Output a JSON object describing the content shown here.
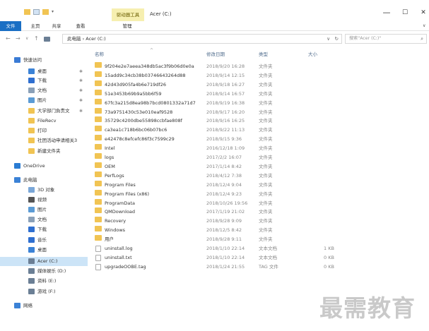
{
  "titlebar": {
    "context_tab": "驱动器工具",
    "title": "Acer (C:)",
    "minimize": "—",
    "maximize": "☐",
    "close": "✕"
  },
  "ribbon": {
    "tabs": [
      "文件",
      "主页",
      "共享",
      "查看",
      "管理"
    ]
  },
  "address": {
    "path": "此电脑 › Acer (C:)",
    "search_placeholder": "搜索\"Acer (C:)\""
  },
  "sidebar": {
    "items": [
      {
        "label": "快速访问",
        "icon": "star-icon",
        "color": "#3a7bd5"
      },
      {
        "label": "桌面",
        "icon": "desktop-icon",
        "color": "#3b82d6",
        "pinned": true
      },
      {
        "label": "下载",
        "icon": "download-icon",
        "color": "#2f6fd0",
        "pinned": true
      },
      {
        "label": "文档",
        "icon": "document-icon",
        "color": "#8aa0b8",
        "pinned": true
      },
      {
        "label": "图片",
        "icon": "picture-icon",
        "color": "#5b9bd5",
        "pinned": true
      },
      {
        "label": "大学部门負责文",
        "icon": "folder-icon",
        "color": "#f1c453",
        "pinned": true
      },
      {
        "label": "FileRecv",
        "icon": "folder-icon",
        "color": "#f1c453"
      },
      {
        "label": "打印",
        "icon": "folder-icon",
        "color": "#f1c453"
      },
      {
        "label": "社团活动申请相关3",
        "icon": "folder-icon",
        "color": "#f1c453"
      },
      {
        "label": "新建文件夹",
        "icon": "folder-icon",
        "color": "#f1c453"
      },
      {
        "label": "OneDrive",
        "icon": "cloud-icon",
        "color": "#2b7cd3"
      },
      {
        "label": "此电脑",
        "icon": "computer-icon",
        "color": "#3b82d6"
      },
      {
        "label": "3D 对象",
        "icon": "cube-icon",
        "color": "#7aa7d8"
      },
      {
        "label": "视频",
        "icon": "video-icon",
        "color": "#555555"
      },
      {
        "label": "图片",
        "icon": "picture-icon",
        "color": "#5b9bd5"
      },
      {
        "label": "文档",
        "icon": "document-icon",
        "color": "#8aa0b8"
      },
      {
        "label": "下载",
        "icon": "download-icon",
        "color": "#2f6fd0"
      },
      {
        "label": "音乐",
        "icon": "music-icon",
        "color": "#2f6fd0"
      },
      {
        "label": "桌面",
        "icon": "desktop-icon",
        "color": "#3b82d6"
      },
      {
        "label": "Acer (C:)",
        "icon": "drive-icon",
        "color": "#6b7f95",
        "selected": true
      },
      {
        "label": "媒体娱乐 (D:)",
        "icon": "drive-icon",
        "color": "#6b7f95"
      },
      {
        "label": "资料 (E:)",
        "icon": "drive-icon",
        "color": "#6b7f95"
      },
      {
        "label": "游戏 (F:)",
        "icon": "drive-icon",
        "color": "#6b7f95"
      },
      {
        "label": "网络",
        "icon": "network-icon",
        "color": "#3b82d6"
      }
    ]
  },
  "columns": {
    "name": "名称",
    "date": "修改日期",
    "type": "类型",
    "size": "大小"
  },
  "files": [
    {
      "name": "9f204e2e7aeea348db5ac3f9b06d0e0a",
      "date": "2018/9/20 16:28",
      "type": "文件夹",
      "size": "",
      "kind": "folder"
    },
    {
      "name": "15add9c34cb38b03746643264d88",
      "date": "2018/9/14 12:15",
      "type": "文件夹",
      "size": "",
      "kind": "folder"
    },
    {
      "name": "42d43d905fa4b6e719df26",
      "date": "2018/9/18 16:27",
      "type": "文件夹",
      "size": "",
      "kind": "folder"
    },
    {
      "name": "51e3453b69b9a5bb6f59",
      "date": "2018/9/14 16:57",
      "type": "文件夹",
      "size": "",
      "kind": "folder"
    },
    {
      "name": "67fc3a215d8ea98b7bcd0801332a71d7",
      "date": "2018/9/19 16:38",
      "type": "文件夹",
      "size": "",
      "kind": "folder"
    },
    {
      "name": "73a9751430c53e010eaf9528",
      "date": "2018/9/17 16:20",
      "type": "文件夹",
      "size": "",
      "kind": "folder"
    },
    {
      "name": "35729c4200dbe55898ccbfae808f",
      "date": "2018/9/16 16:25",
      "type": "文件夹",
      "size": "",
      "kind": "folder"
    },
    {
      "name": "ca3ea1c718b6bc06b07bc6",
      "date": "2018/9/22 11:13",
      "type": "文件夹",
      "size": "",
      "kind": "folder"
    },
    {
      "name": "e42478c8efcefc86f3c7599c29",
      "date": "2018/9/15 9:36",
      "type": "文件夹",
      "size": "",
      "kind": "folder"
    },
    {
      "name": "Intel",
      "date": "2016/12/18 1:09",
      "type": "文件夹",
      "size": "",
      "kind": "folder"
    },
    {
      "name": "logs",
      "date": "2017/2/2 16:07",
      "type": "文件夹",
      "size": "",
      "kind": "folder"
    },
    {
      "name": "OEM",
      "date": "2017/1/14 8:42",
      "type": "文件夹",
      "size": "",
      "kind": "folder"
    },
    {
      "name": "PerfLogs",
      "date": "2018/4/12 7:38",
      "type": "文件夹",
      "size": "",
      "kind": "folder"
    },
    {
      "name": "Program Files",
      "date": "2018/12/4 9:04",
      "type": "文件夹",
      "size": "",
      "kind": "folder"
    },
    {
      "name": "Program Files (x86)",
      "date": "2018/12/4 9:23",
      "type": "文件夹",
      "size": "",
      "kind": "folder"
    },
    {
      "name": "ProgramData",
      "date": "2018/10/26 19:56",
      "type": "文件夹",
      "size": "",
      "kind": "folder"
    },
    {
      "name": "QMDownload",
      "date": "2017/1/19 21:02",
      "type": "文件夹",
      "size": "",
      "kind": "folder"
    },
    {
      "name": "Recovery",
      "date": "2018/9/28 9:09",
      "type": "文件夹",
      "size": "",
      "kind": "folder"
    },
    {
      "name": "Windows",
      "date": "2018/12/5 8:42",
      "type": "文件夹",
      "size": "",
      "kind": "folder"
    },
    {
      "name": "用户",
      "date": "2018/9/28 9:11",
      "type": "文件夹",
      "size": "",
      "kind": "folder"
    },
    {
      "name": "uninstall.log",
      "date": "2018/1/10 22:14",
      "type": "文本文档",
      "size": "1 KB",
      "kind": "doc"
    },
    {
      "name": "uninstall.txt",
      "date": "2018/1/10 22:14",
      "type": "文本文档",
      "size": "0 KB",
      "kind": "doc"
    },
    {
      "name": "upgradeOOBE.tag",
      "date": "2018/1/24 21:55",
      "type": "TAG 文件",
      "size": "0 KB",
      "kind": "doc"
    }
  ],
  "watermark": "最需教育"
}
